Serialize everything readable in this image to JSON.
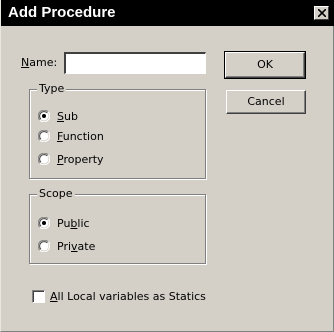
{
  "window": {
    "title": "Add Procedure",
    "close_icon": "close-icon"
  },
  "name_field": {
    "label_accesskey": "N",
    "label_rest": "ame:",
    "value": "",
    "placeholder": ""
  },
  "buttons": {
    "ok": "OK",
    "cancel": "Cancel"
  },
  "type_group": {
    "legend": "Type",
    "options": [
      {
        "pre": "",
        "key": "S",
        "post": "ub",
        "selected": true
      },
      {
        "pre": "",
        "key": "F",
        "post": "unction",
        "selected": false
      },
      {
        "pre": "",
        "key": "P",
        "post": "roperty",
        "selected": false
      }
    ]
  },
  "scope_group": {
    "legend": "Scope",
    "options": [
      {
        "pre": "Pu",
        "key": "b",
        "post": "lic",
        "selected": true
      },
      {
        "pre": "Pri",
        "key": "v",
        "post": "ate",
        "selected": false
      }
    ]
  },
  "statics_checkbox": {
    "pre": "",
    "key": "A",
    "post": "ll Local variables as Statics",
    "checked": false
  },
  "colors": {
    "dialog_face": "#d4d0c8",
    "titlebar": "#000000",
    "title_text": "#ffffff"
  }
}
